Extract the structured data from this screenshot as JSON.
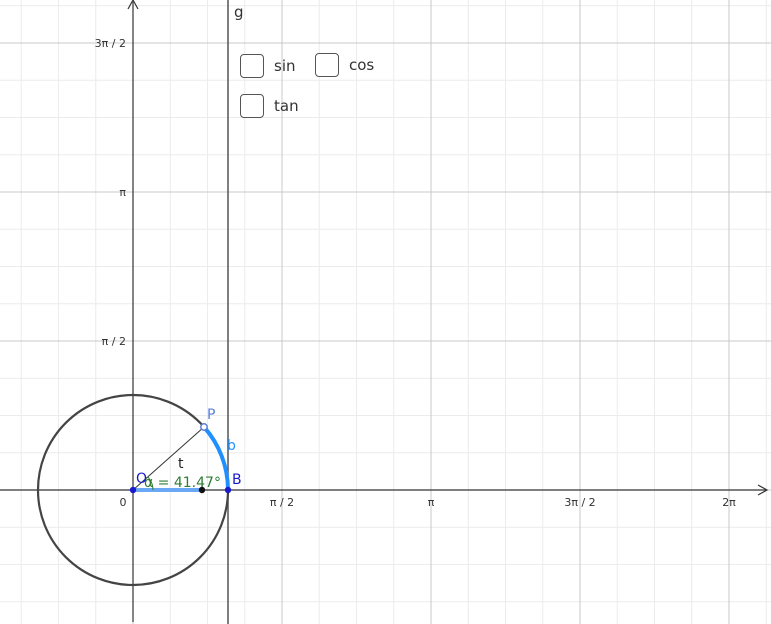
{
  "graph": {
    "x_ticks": [
      {
        "label": "0",
        "value": 0
      },
      {
        "label": "π / 2",
        "value": 1.5708
      },
      {
        "label": "π",
        "value": 3.1416
      },
      {
        "label": "3π / 2",
        "value": 4.7124
      },
      {
        "label": "2π",
        "value": 6.2832
      }
    ],
    "y_ticks": [
      {
        "label": "π / 2",
        "value": 1.5708
      },
      {
        "label": "π",
        "value": 3.1416
      },
      {
        "label": "3π / 2",
        "value": 4.7124
      }
    ],
    "unit_circle_radius": 1,
    "angle_alpha_degrees": 41.47,
    "line_g_x": 1
  },
  "labels": {
    "line_g": "g",
    "point_origin": "O",
    "point_b": "B",
    "point_p": "P",
    "arc_b": "b",
    "segment_t": "t",
    "angle_alpha": "α = 41.47°"
  },
  "checkboxes": [
    {
      "id": "sin",
      "label": "sin",
      "checked": false
    },
    {
      "id": "cos",
      "label": "cos",
      "checked": false
    },
    {
      "id": "tan",
      "label": "tan",
      "checked": false
    }
  ],
  "colors": {
    "grid_major": "#c8c8c8",
    "grid_minor": "#ececec",
    "axis": "#333333",
    "circle": "#444444",
    "arc": "#1e90ff",
    "angle_text": "#2e7d32",
    "point_label": "#5a7fd8",
    "point_b": "#1a1acc",
    "segment": "#6aa7f5"
  }
}
